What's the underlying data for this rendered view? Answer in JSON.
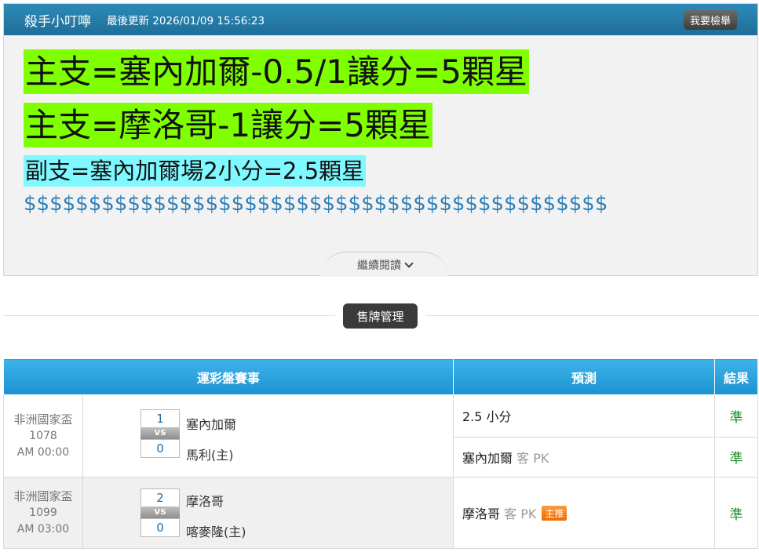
{
  "header": {
    "author": "殺手小叮嚀",
    "updated_label": "最後更新",
    "updated_time": "2026/01/09 15:56:23",
    "report_button": "我要檢舉"
  },
  "article": {
    "line1": "主支=塞內加爾-0.5/1讓分=5顆星",
    "line2": "主支=摩洛哥-1讓分=5顆星",
    "line3": "副支=塞內加爾場2小分=2.5顆星",
    "line4": "$$$$$$$$$$$$$$$$$$$$$$$$$$$$$$$$$$$$$$$$$$$$$",
    "read_more": "繼續閱讀"
  },
  "sales_button": "售牌管理",
  "table": {
    "headers": [
      "運彩盤賽事",
      "預測",
      "結果"
    ],
    "matches": [
      {
        "league": "非洲國家盃",
        "code": "1078",
        "time": "AM 00:00",
        "home_score": "1",
        "vs": "VS",
        "away_score": "0",
        "team1": "塞內加爾",
        "team2": "馬利(主)",
        "predictions": [
          {
            "text": "2.5 小分",
            "side": "",
            "line": "",
            "badge": "",
            "result": "準"
          },
          {
            "text": "塞內加爾",
            "side": "客",
            "line": "PK",
            "badge": "",
            "result": "準"
          }
        ]
      },
      {
        "league": "非洲國家盃",
        "code": "1099",
        "time": "AM 03:00",
        "home_score": "2",
        "vs": "VS",
        "away_score": "0",
        "team1": "摩洛哥",
        "team2": "喀麥隆(主)",
        "predictions": [
          {
            "text": "摩洛哥",
            "side": "客",
            "line": "PK",
            "badge": "主推",
            "result": "準"
          }
        ]
      }
    ]
  },
  "colors": {
    "header_blue": "#1e6e98",
    "table_header_blue": "#1a93d2",
    "highlight_green": "#7fff00",
    "highlight_cyan": "#7ff8ff",
    "dollar_blue": "#2c7fb8",
    "result_green": "#1a8a2a",
    "badge_orange": "#f06b00"
  }
}
